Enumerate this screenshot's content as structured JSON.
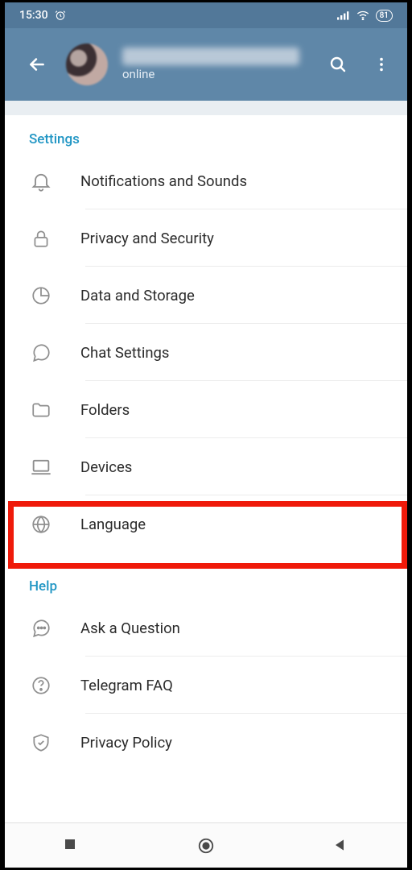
{
  "statusbar": {
    "time": "15:30",
    "battery": "81"
  },
  "header": {
    "status": "online"
  },
  "sections": {
    "settings": {
      "title": "Settings",
      "items": [
        {
          "label": "Notifications and Sounds"
        },
        {
          "label": "Privacy and Security"
        },
        {
          "label": "Data and Storage"
        },
        {
          "label": "Chat Settings"
        },
        {
          "label": "Folders"
        },
        {
          "label": "Devices"
        },
        {
          "label": "Language"
        }
      ]
    },
    "help": {
      "title": "Help",
      "items": [
        {
          "label": "Ask a Question"
        },
        {
          "label": "Telegram FAQ"
        },
        {
          "label": "Privacy Policy"
        }
      ]
    }
  },
  "highlighted_item": "Language"
}
